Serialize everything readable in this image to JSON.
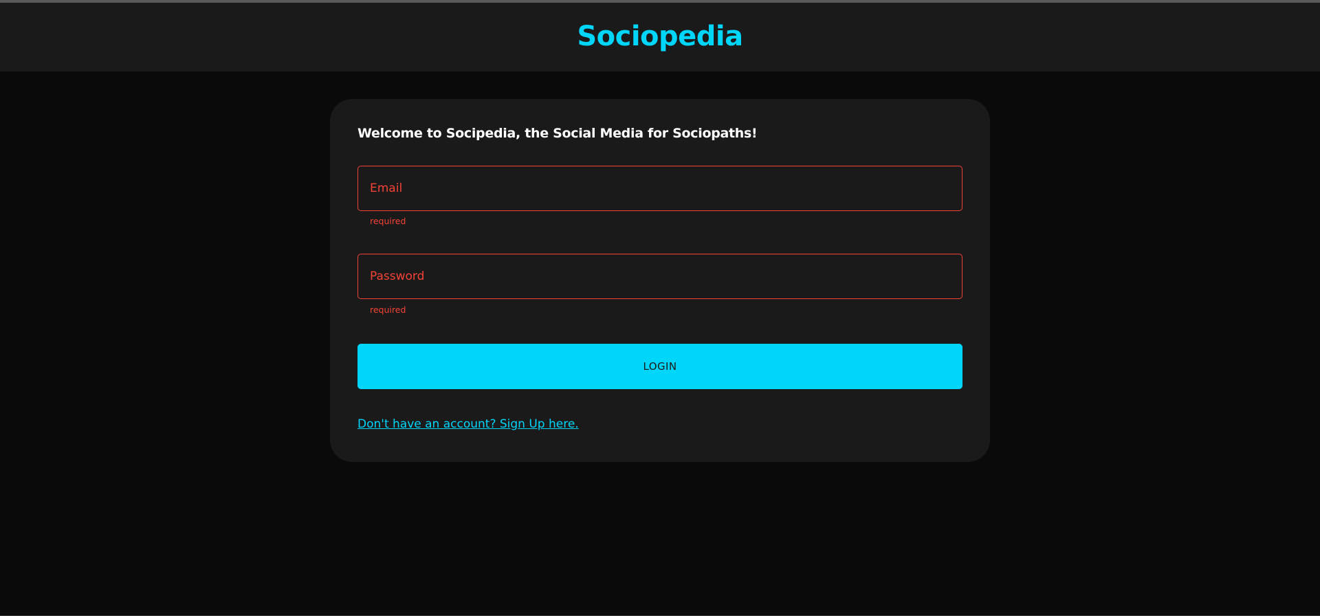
{
  "header": {
    "brand": "Sociopedia"
  },
  "login_form": {
    "welcome": "Welcome to Socipedia, the Social Media for Sociopaths!",
    "email": {
      "placeholder": "Email",
      "value": "",
      "helper": "required"
    },
    "password": {
      "placeholder": "Password",
      "value": "",
      "helper": "required"
    },
    "login_label": "LOGIN",
    "signup_link": "Don't have an account? Sign Up here."
  },
  "colors": {
    "accent": "#00d5fa",
    "error": "#f44336",
    "page_background": "#0a0a0a",
    "surface": "#1a1a1a"
  }
}
